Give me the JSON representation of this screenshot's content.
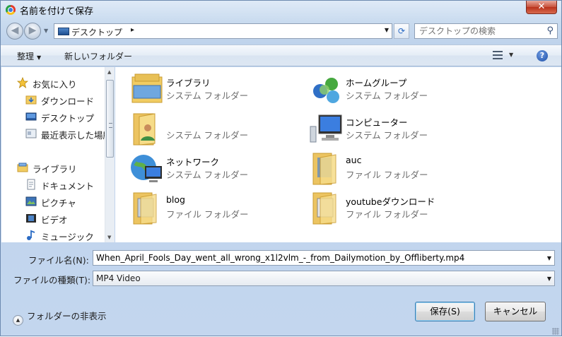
{
  "window": {
    "title": "名前を付けて保存",
    "close_label": "✕"
  },
  "address_bar": {
    "location": "デスクトップ",
    "separator": "▸"
  },
  "search": {
    "placeholder": "デスクトップの検索"
  },
  "toolbar": {
    "organize_label": "整理",
    "new_folder_label": "新しいフォルダー",
    "help_label": "?"
  },
  "nav_pane": {
    "items": [
      {
        "label": "お気に入り",
        "icon": "star-icon"
      },
      {
        "label": "ダウンロード",
        "icon": "download-folder-icon"
      },
      {
        "label": "デスクトップ",
        "icon": "desktop-icon"
      },
      {
        "label": "最近表示した場所",
        "icon": "recent-places-icon"
      },
      {
        "label": "ライブラリ",
        "icon": "library-icon"
      },
      {
        "label": "ドキュメント",
        "icon": "document-icon"
      },
      {
        "label": "ピクチャ",
        "icon": "pictures-icon"
      },
      {
        "label": "ビデオ",
        "icon": "video-icon"
      },
      {
        "label": "ミュージック",
        "icon": "music-icon"
      }
    ]
  },
  "files": [
    {
      "name": "ライブラリ",
      "type": "システム フォルダー",
      "icon": "library-icon"
    },
    {
      "name": "ホームグループ",
      "type": "システム フォルダー",
      "icon": "homegroup-icon"
    },
    {
      "name": "",
      "type": "システム フォルダー",
      "icon": "user-folder-icon"
    },
    {
      "name": "コンピューター",
      "type": "システム フォルダー",
      "icon": "computer-icon"
    },
    {
      "name": "ネットワーク",
      "type": "システム フォルダー",
      "icon": "network-icon"
    },
    {
      "name": "auc",
      "type": "ファイル フォルダー",
      "icon": "folder-icon"
    },
    {
      "name": "blog",
      "type": "ファイル フォルダー",
      "icon": "folder-icon"
    },
    {
      "name": "youtubeダウンロード",
      "type": "ファイル フォルダー",
      "icon": "folder-icon"
    }
  ],
  "form": {
    "filename_label": "ファイル名(N):",
    "filename_value": "When_April_Fools_Day_went_all_wrong_x1l2vlm_-_from_Dailymotion_by_Offliberty.mp4",
    "filetype_label": "ファイルの種類(T):",
    "filetype_value": "MP4 Video",
    "hide_folders_label": "フォルダーの非表示",
    "save_label": "保存(S)",
    "cancel_label": "キャンセル"
  },
  "colors": {
    "window_bg": "#c9dbef",
    "accent": "#3c7fb1",
    "secondary_text": "#6d6d6d"
  }
}
